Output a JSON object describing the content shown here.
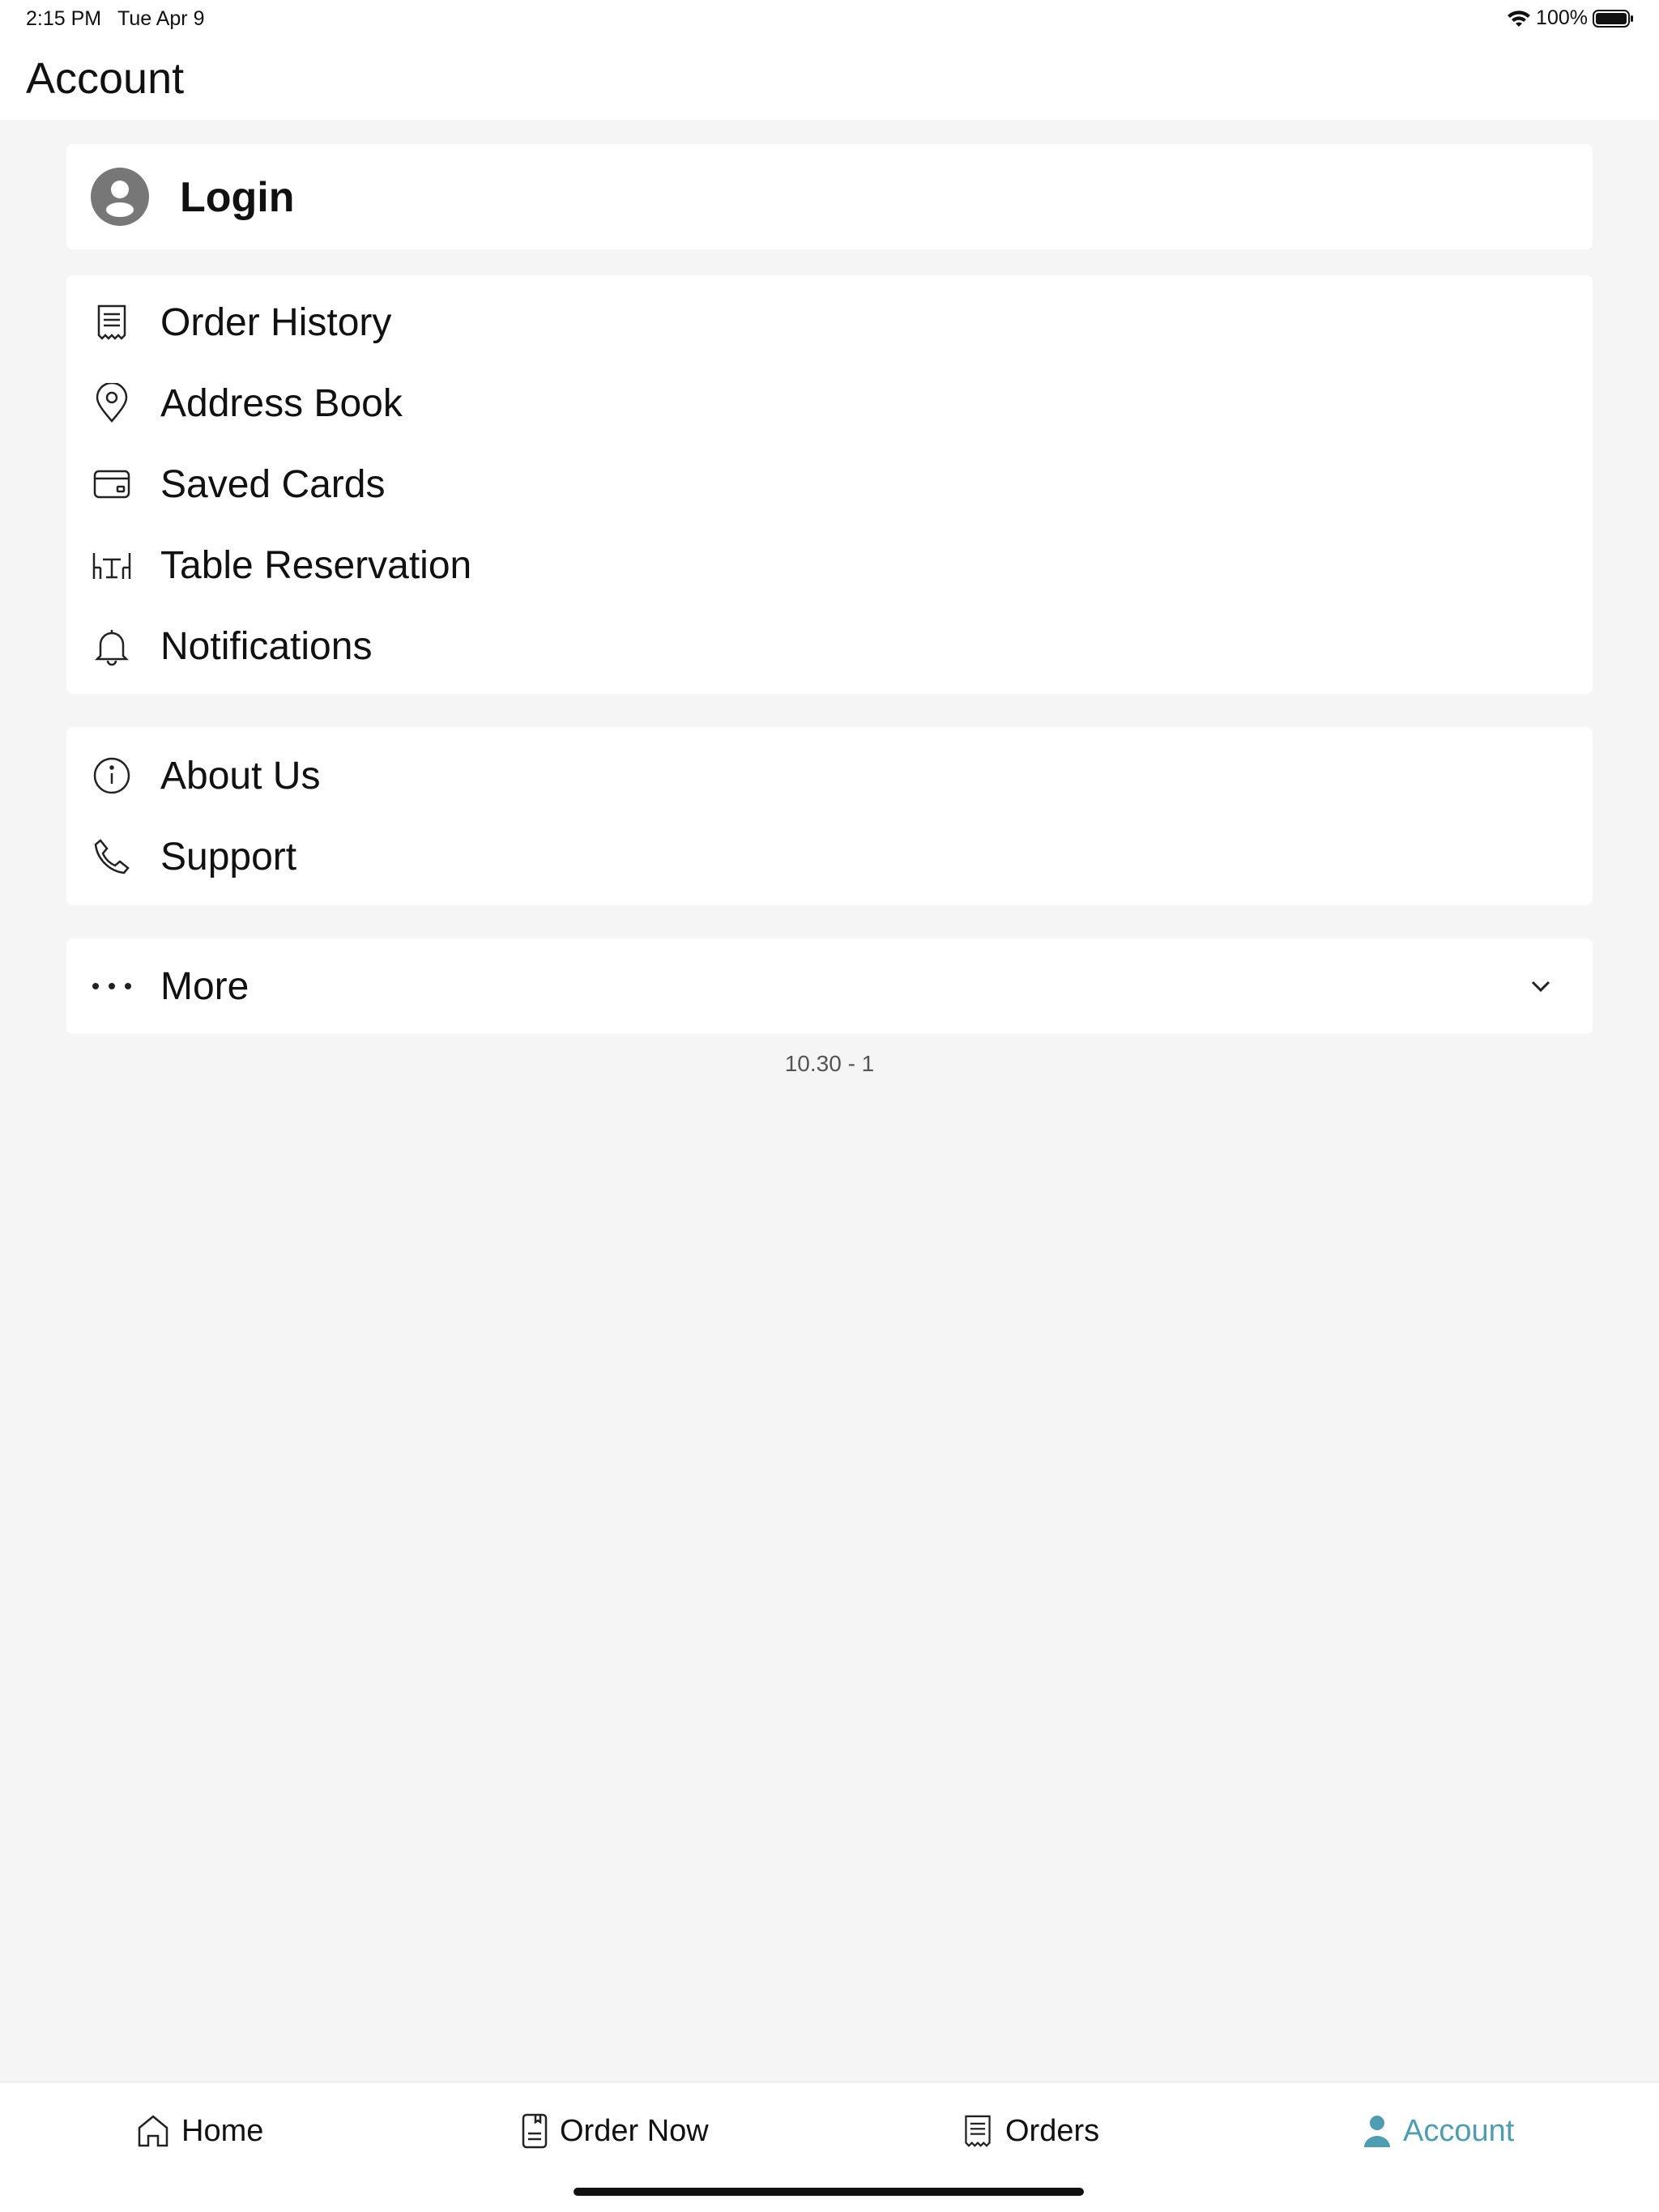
{
  "status_bar": {
    "time": "2:15 PM",
    "date": "Tue Apr 9",
    "battery": "100%"
  },
  "header": {
    "title": "Account"
  },
  "login": {
    "label": "Login"
  },
  "menu_main": [
    {
      "label": "Order History",
      "icon": "receipt-icon"
    },
    {
      "label": "Address Book",
      "icon": "location-pin-icon"
    },
    {
      "label": "Saved Cards",
      "icon": "credit-card-icon"
    },
    {
      "label": "Table Reservation",
      "icon": "dining-table-icon"
    },
    {
      "label": "Notifications",
      "icon": "bell-icon"
    }
  ],
  "menu_info": [
    {
      "label": "About Us",
      "icon": "info-icon"
    },
    {
      "label": "Support",
      "icon": "phone-icon"
    }
  ],
  "more": {
    "label": "More",
    "icon": "ellipsis-icon"
  },
  "version": "10.30 - 1",
  "tabs": [
    {
      "label": "Home",
      "icon": "home-icon"
    },
    {
      "label": "Order Now",
      "icon": "menu-book-icon"
    },
    {
      "label": "Orders",
      "icon": "receipt-icon"
    },
    {
      "label": "Account",
      "icon": "person-icon"
    }
  ],
  "colors": {
    "accent": "#4f9db0",
    "background": "#f5f5f5",
    "card": "#ffffff",
    "avatar": "#777777"
  }
}
